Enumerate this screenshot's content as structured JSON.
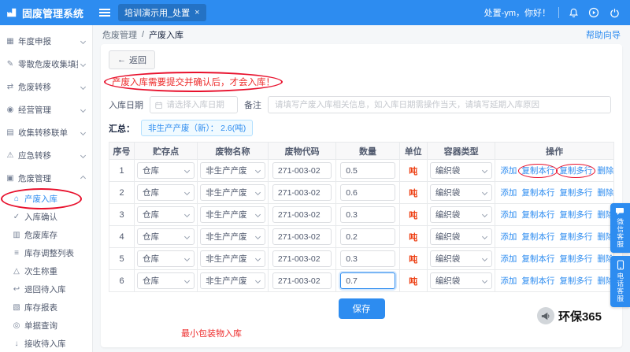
{
  "colors": {
    "accent": "#2d8cf0",
    "annotation": "#e8112d",
    "danger": "#ed4014"
  },
  "header": {
    "app_title": "固废管理系统",
    "tab_label": "培训演示用_处置",
    "greeting": "处置-ym，你好！"
  },
  "sidebar": {
    "items": [
      {
        "name": "annual-report",
        "label": "年度申报",
        "level": 1,
        "icon": "calendar-icon",
        "arrow": true
      },
      {
        "name": "scattered-waste-report",
        "label": "零散危废收集填报",
        "level": 1,
        "icon": "form-icon",
        "arrow": true
      },
      {
        "name": "waste-transfer",
        "label": "危废转移",
        "level": 1,
        "icon": "transfer-icon",
        "arrow": true
      },
      {
        "name": "operation-management",
        "label": "经营管理",
        "level": 1,
        "icon": "manage-icon",
        "arrow": true
      },
      {
        "name": "collect-transfer-manifest",
        "label": "收集转移联单",
        "level": 1,
        "icon": "list-icon",
        "arrow": true
      },
      {
        "name": "emergency-transfer",
        "label": "应急转移",
        "level": 1,
        "icon": "emergency-icon",
        "arrow": true
      },
      {
        "name": "waste-management",
        "label": "危废管理",
        "level": 1,
        "icon": "waste-manage-icon",
        "arrow": true,
        "expanded": true
      },
      {
        "name": "waste-inbound",
        "label": "产废入库",
        "level": 2,
        "icon": "inbound-icon",
        "active": true,
        "annotated": true
      },
      {
        "name": "inbound-confirm",
        "label": "入库确认",
        "level": 2,
        "icon": "confirm-icon"
      },
      {
        "name": "waste-stock",
        "label": "危废库存",
        "level": 2,
        "icon": "stock-icon"
      },
      {
        "name": "stock-adjust-list",
        "label": "库存调整列表",
        "level": 2,
        "icon": "adjust-icon"
      },
      {
        "name": "secondary-weighing",
        "label": "次生称重",
        "level": 2,
        "icon": "weigh-icon"
      },
      {
        "name": "return-pending-inbound",
        "label": "退回待入库",
        "level": 2,
        "icon": "return-icon"
      },
      {
        "name": "stock-report",
        "label": "库存报表",
        "level": 2,
        "icon": "report-icon"
      },
      {
        "name": "document-query",
        "label": "单据查询",
        "level": 2,
        "icon": "query-icon"
      },
      {
        "name": "receive-pending-inbound",
        "label": "接收待入库",
        "level": 2,
        "icon": "receive-icon"
      }
    ]
  },
  "breadcrumb": {
    "section": "危废管理",
    "separator": "/",
    "current": "产废入库",
    "help": "帮助向导"
  },
  "toolbar": {
    "back_label": "返回"
  },
  "notice": "产废入库需要提交并确认后，才会入库！",
  "form": {
    "date_label": "入库日期",
    "date_placeholder": "请选择入库日期",
    "note_label": "备注",
    "note_placeholder": "请填写产废入库相关信息，如入库日期需操作当天，请填写延期入库原因"
  },
  "summary": {
    "label": "汇总：",
    "tag": "非生产产废（新）： 2.6(吨)"
  },
  "table": {
    "headers": [
      "序号",
      "贮存点",
      "废物名称",
      "废物代码",
      "数量",
      "单位",
      "容器类型",
      "操作"
    ],
    "actions": [
      "添加",
      "复制本行",
      "复制多行",
      "删除"
    ],
    "rows": [
      {
        "no": "1",
        "storage": "仓库",
        "waste_name": "非生产产废",
        "code": "271-003-02",
        "qty": "0.5",
        "unit": "吨",
        "container": "编织袋",
        "circled": [
          "复制本行",
          "复制多行"
        ]
      },
      {
        "no": "2",
        "storage": "仓库",
        "waste_name": "非生产产废",
        "code": "271-003-02",
        "qty": "0.6",
        "unit": "吨",
        "container": "编织袋"
      },
      {
        "no": "3",
        "storage": "仓库",
        "waste_name": "非生产产废",
        "code": "271-003-02",
        "qty": "0.3",
        "unit": "吨",
        "container": "编织袋"
      },
      {
        "no": "4",
        "storage": "仓库",
        "waste_name": "非生产产废",
        "code": "271-003-02",
        "qty": "0.2",
        "unit": "吨",
        "container": "编织袋"
      },
      {
        "no": "5",
        "storage": "仓库",
        "waste_name": "非生产产废",
        "code": "271-003-02",
        "qty": "0.3",
        "unit": "吨",
        "container": "编织袋"
      },
      {
        "no": "6",
        "storage": "仓库",
        "waste_name": "非生产产废",
        "code": "271-003-02",
        "qty": "0.7",
        "unit": "吨",
        "container": "编织袋",
        "focused": true
      }
    ]
  },
  "save_label": "保存",
  "footnote": "最小包装物入库",
  "floating": {
    "wechat": "微信客服",
    "phone": "电话客服"
  },
  "watermark": "环保365"
}
